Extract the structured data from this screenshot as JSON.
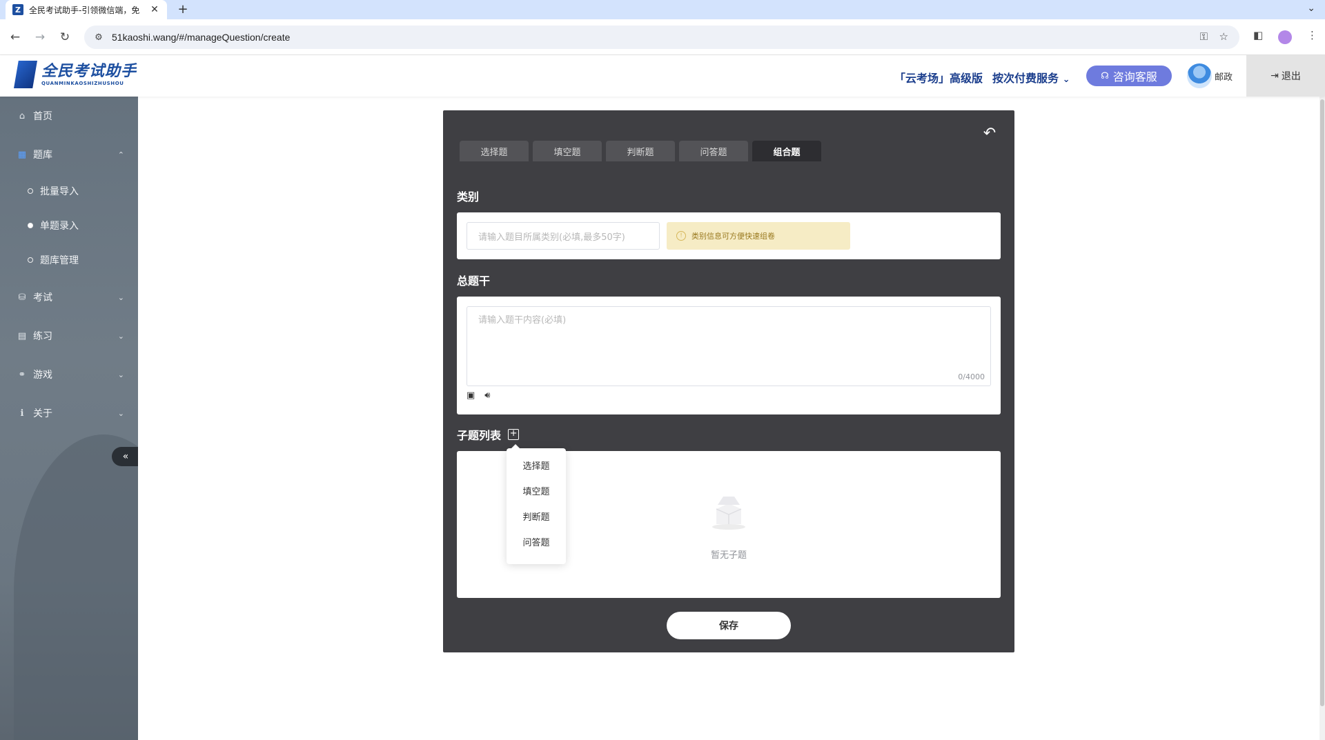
{
  "browser": {
    "tab_title": "全民考试助手-引领微信端，免",
    "tab_close": "✕",
    "new_tab": "+",
    "url": "51kaoshi.wang/#/manageQuestion/create"
  },
  "header": {
    "logo_cn": "全民考试助手",
    "logo_en": "QUANMINKAOSHIZHUSHOU",
    "cloud_exam": "「云考场」高级版",
    "pay_service": "按次付费服务",
    "consult": "咨询客服",
    "user_name": "邮政",
    "logout": "退出"
  },
  "sidebar": {
    "items": [
      {
        "label": "首页"
      },
      {
        "label": "题库"
      },
      {
        "label": "考试"
      },
      {
        "label": "练习"
      },
      {
        "label": "游戏"
      },
      {
        "label": "关于"
      }
    ],
    "sub_items": [
      {
        "label": "批量导入"
      },
      {
        "label": "单题录入"
      },
      {
        "label": "题库管理"
      }
    ],
    "collapse": "«"
  },
  "panel": {
    "tabs": [
      {
        "label": "选择题"
      },
      {
        "label": "填空题"
      },
      {
        "label": "判断题"
      },
      {
        "label": "问答题"
      },
      {
        "label": "组合题"
      }
    ],
    "category_title": "类别",
    "category_placeholder": "请输入题目所属类别(必填,最多50字)",
    "category_tip": "类别信息可方便快速组卷",
    "stem_title": "总题干",
    "stem_placeholder": "请输入题干内容(必填)",
    "stem_counter": "0/4000",
    "sub_list_title": "子题列表",
    "empty_text": "暂无子题",
    "save": "保存",
    "dropdown": [
      {
        "label": "选择题"
      },
      {
        "label": "填空题"
      },
      {
        "label": "判断题"
      },
      {
        "label": "问答题"
      }
    ]
  },
  "colors": {
    "panel_bg": "#3f3f43",
    "consult_bg": "#6e7bde",
    "brand": "#1d4fa0",
    "tip_bg": "#f6ecc5"
  }
}
